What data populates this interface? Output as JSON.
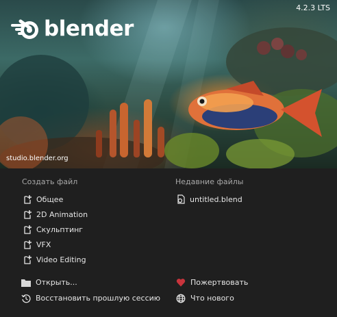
{
  "version": "4.2.3 LTS",
  "logo_text": "blender",
  "credit": "studio.blender.org",
  "new_file": {
    "title": "Создать файл",
    "items": [
      {
        "label": "Общее",
        "icon": "new-file-icon"
      },
      {
        "label": "2D Animation",
        "icon": "new-file-icon"
      },
      {
        "label": "Скульптинг",
        "icon": "new-file-icon"
      },
      {
        "label": "VFX",
        "icon": "new-file-icon"
      },
      {
        "label": "Video Editing",
        "icon": "new-file-icon"
      }
    ]
  },
  "recent": {
    "title": "Недавние файлы",
    "items": [
      {
        "label": "untitled.blend",
        "icon": "blend-file-icon"
      }
    ]
  },
  "actions_left": {
    "open": {
      "label": "Открыть...",
      "icon": "folder-icon"
    },
    "recover": {
      "label": "Восстановить прошлую сессию",
      "icon": "recover-icon"
    }
  },
  "actions_right": {
    "donate": {
      "label": "Пожертвовать",
      "icon": "heart-icon"
    },
    "whats_new": {
      "label": "Что нового",
      "icon": "globe-icon"
    }
  },
  "colors": {
    "background": "#1f1f1f",
    "text": "#e6e6e6",
    "muted": "#a8a8a8",
    "heart": "#c8343c"
  }
}
